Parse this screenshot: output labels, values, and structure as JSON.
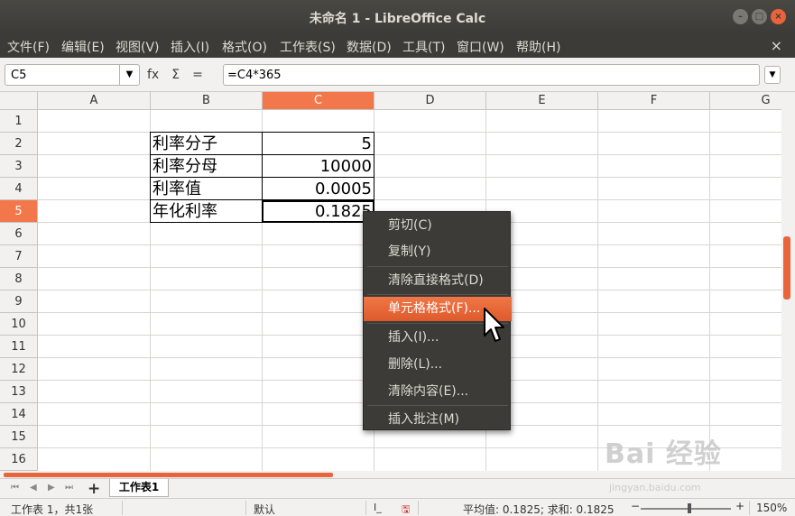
{
  "window": {
    "title": "未命名 1 - LibreOffice Calc"
  },
  "menu": [
    "文件(F)",
    "编辑(E)",
    "视图(V)",
    "插入(I)",
    "格式(O)",
    "工作表(S)",
    "数据(D)",
    "工具(T)",
    "窗口(W)",
    "帮助(H)"
  ],
  "formula_bar": {
    "name_box": "C5",
    "fx": "fx",
    "sum": "Σ",
    "equals": "=",
    "formula": "=C4*365"
  },
  "columns": [
    "A",
    "B",
    "C",
    "D",
    "E",
    "F",
    "G"
  ],
  "rows": [
    "1",
    "2",
    "3",
    "4",
    "5",
    "6",
    "7",
    "8",
    "9",
    "10",
    "11",
    "12",
    "13",
    "14",
    "15",
    "16"
  ],
  "cells": {
    "B2": "利率分子",
    "C2": "5",
    "B3": "利率分母",
    "C3": "10000",
    "B4": "利率值",
    "C4": "0.0005",
    "B5": "年化利率",
    "C5": "0.1825"
  },
  "context_menu": {
    "cut": "剪切(C)",
    "copy": "复制(Y)",
    "clear_direct": "清除直接格式(D)",
    "format_cells": "单元格格式(F)...",
    "insert": "插入(I)...",
    "delete": "删除(L)...",
    "clear_contents": "清除内容(E)...",
    "insert_comment": "插入批注(M)"
  },
  "sheet_tab": "工作表1",
  "status": {
    "sheet_info": "工作表 1，共1张",
    "page_style": "默认",
    "summary": "平均值: 0.1825; 求和: 0.1825",
    "zoom": "150%",
    "zoom_minus": "−",
    "zoom_plus": "+"
  },
  "watermark": {
    "text": "Bai  经验",
    "url": "jingyan.baidu.com"
  }
}
